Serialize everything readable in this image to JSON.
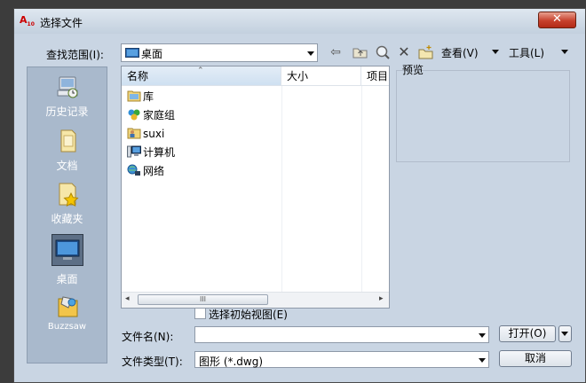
{
  "window": {
    "title": "选择文件",
    "app_icon_text": "A",
    "app_icon_sub": "10"
  },
  "toolbar": {
    "look_in_label": "查找范围(I):",
    "look_in_value": "桌面",
    "views_label": "查看(V)",
    "tools_label": "工具(L)"
  },
  "places": [
    {
      "label": "历史记录",
      "icon": "history-icon"
    },
    {
      "label": "文档",
      "icon": "documents-icon"
    },
    {
      "label": "收藏夹",
      "icon": "favorites-icon"
    },
    {
      "label": "桌面",
      "icon": "desktop-icon"
    },
    {
      "label": "Buzzsaw",
      "icon": "buzzsaw-icon"
    }
  ],
  "filelist": {
    "columns": [
      "名称",
      "大小",
      "项目多"
    ],
    "items": [
      {
        "name": "库",
        "icon": "library-icon"
      },
      {
        "name": "家庭组",
        "icon": "homegroup-icon"
      },
      {
        "name": "suxi",
        "icon": "user-folder-icon"
      },
      {
        "name": "计算机",
        "icon": "computer-icon"
      },
      {
        "name": "网络",
        "icon": "network-icon"
      }
    ],
    "scroll_thumb": "III"
  },
  "preview": {
    "label": "预览"
  },
  "initial_view": {
    "label": "选择初始视图(E)",
    "checked": false
  },
  "filename": {
    "label": "文件名(N):",
    "value": ""
  },
  "filetype": {
    "label": "文件类型(T):",
    "value": "图形 (*.dwg)"
  },
  "buttons": {
    "open": "打开(O)",
    "cancel": "取消"
  }
}
